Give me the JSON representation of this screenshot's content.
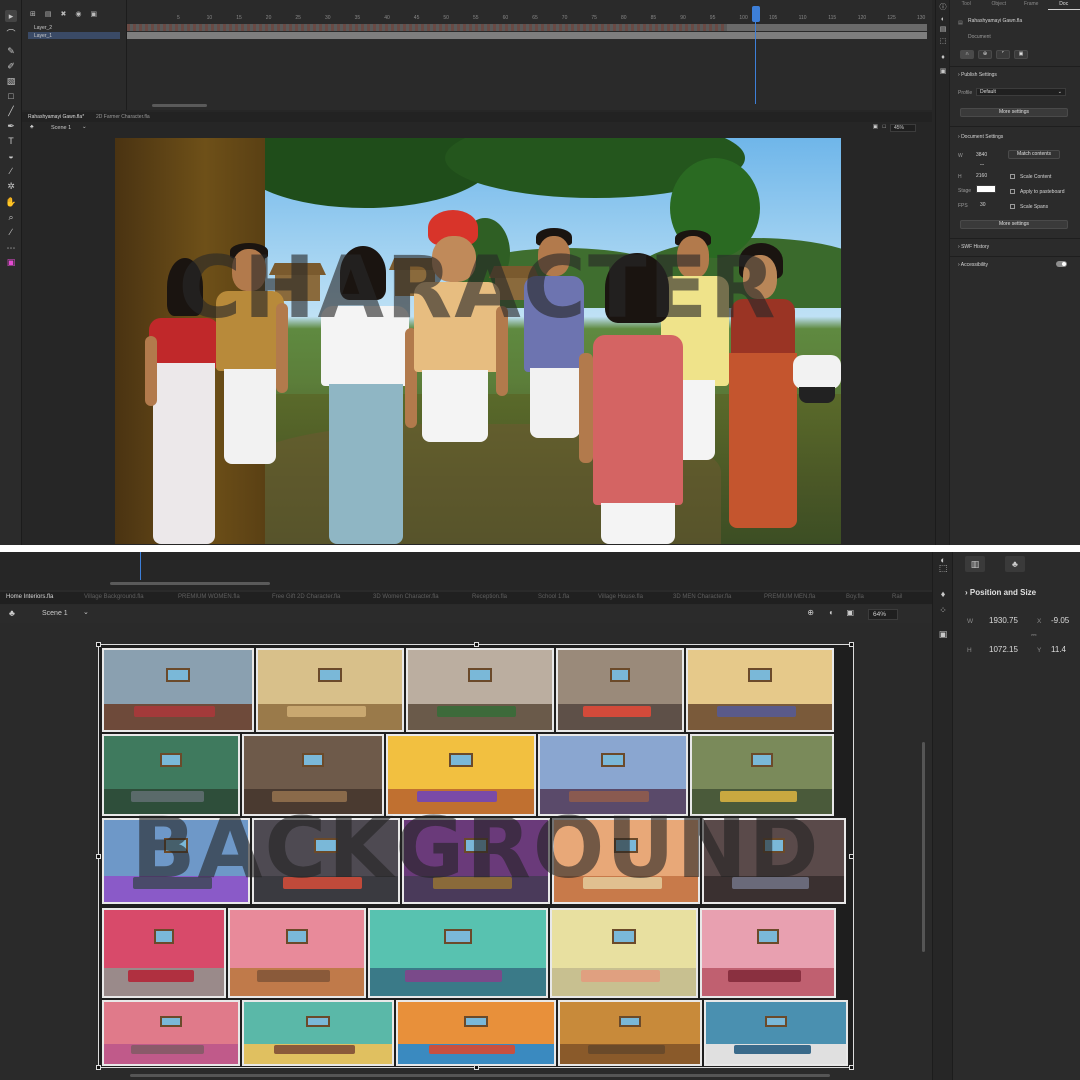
{
  "top": {
    "timeline": {
      "layers": [
        "Layer_2",
        "Layer_1"
      ],
      "ruler": [
        "5",
        "10",
        "15",
        "20",
        "25",
        "30",
        "35",
        "40",
        "45",
        "50",
        "55",
        "60",
        "65",
        "70",
        "75",
        "80",
        "85",
        "90",
        "95",
        "100",
        "105",
        "110",
        "115",
        "120",
        "125",
        "130"
      ]
    },
    "tabs": [
      "Rahashyamayi Gawn.fla*",
      "2D Farmer Character.fla"
    ],
    "scene": "Scene 1",
    "zoom": "45%",
    "watermark": "CHARACTER",
    "panel": {
      "tabs": [
        "Tool",
        "Object",
        "Frame",
        "Doc"
      ],
      "active_tab": "Doc",
      "doc_name": "Rahashyamayi Gawn.fla",
      "doc_label": "Document",
      "publish_settings": "Publish Settings",
      "profile_label": "Profile",
      "profile_value": "Default",
      "more_settings": "More settings",
      "document_settings": "Document Settings",
      "w_label": "W",
      "w_value": "3840",
      "h_label": "H",
      "h_value": "2160",
      "match_contents": "Match contents",
      "scale_content": "Scale Content",
      "stage_label": "Stage",
      "apply_pasteboard": "Apply to pasteboard",
      "fps_label": "FPS",
      "fps_value": "30",
      "scale_spans": "Scale Spans",
      "more_settings_2": "More settings",
      "swf_history": "SWF History",
      "accessibility": "Accessibility"
    }
  },
  "bottom": {
    "tabs": [
      "Home Interiors.fla",
      "Village Background.fla",
      "PREMIUM WOMEN.fla",
      "Free Gift 2D Character.fla",
      "3D Women Character.fla",
      "Reception.fla",
      "School 1.fla",
      "Village House.fla",
      "3D MEN Character.fla",
      "PREMIUM MEN.fla",
      "Boy.fla",
      "Rail"
    ],
    "scene": "Scene 1",
    "zoom": "64%",
    "watermark": "BACKGROUND",
    "position_and_size": "Position and Size",
    "w_label": "W",
    "w_value": "1930.75",
    "h_label": "H",
    "h_value": "1072.15",
    "x_label": "X",
    "x_value": "-9.05",
    "y_label": "Y",
    "y_value": "11.4"
  },
  "colors": {
    "accent": "#3d7fd8",
    "panel": "#2b2b2b",
    "canvas_bg": "#262626"
  }
}
